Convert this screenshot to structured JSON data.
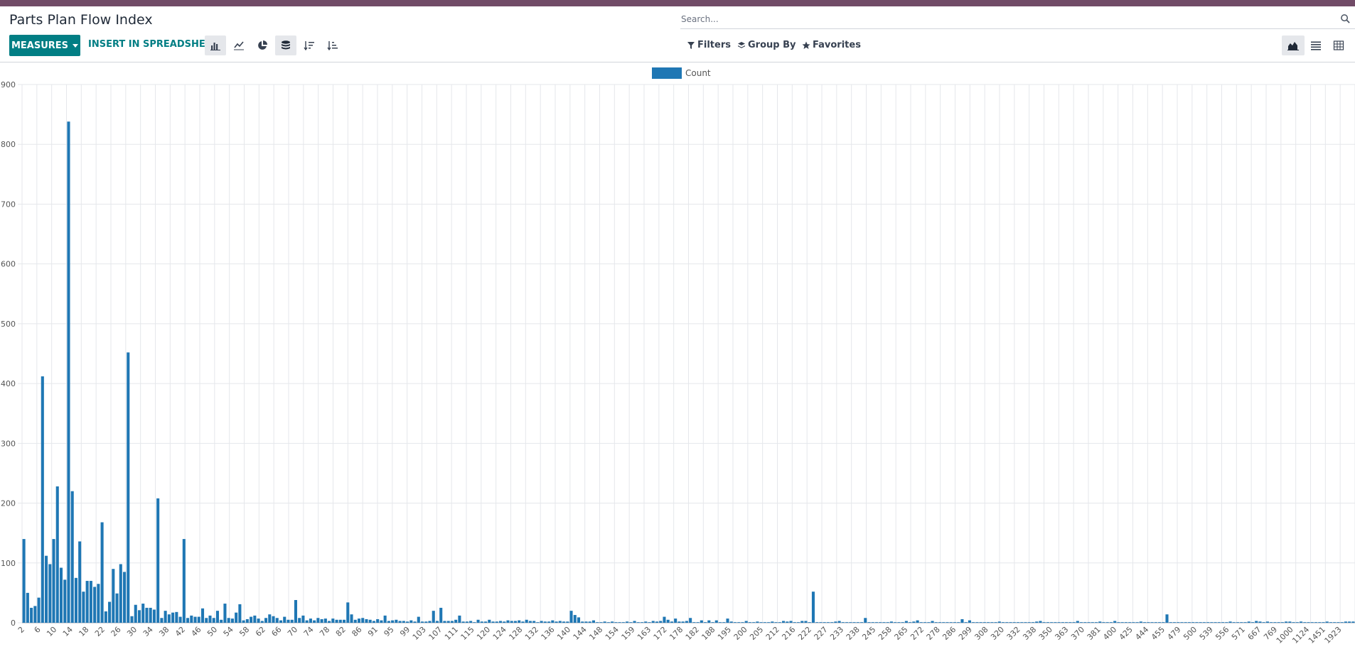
{
  "header": {
    "title": "Parts Plan Flow Index",
    "search_placeholder": "Search..."
  },
  "toolbar": {
    "measures_label": "MEASURES",
    "spreadsheet_label": "INSERT IN SPREADSHEET",
    "filters_label": "Filters",
    "groupby_label": "Group By",
    "favorites_label": "Favorites"
  },
  "icons": [
    "bar-chart-icon",
    "line-chart-icon",
    "pie-chart-icon",
    "stacked-icon",
    "sort-desc-icon",
    "sort-asc-icon",
    "filter-icon",
    "layers-icon",
    "star-icon",
    "graph-view-icon",
    "list-view-icon",
    "pivot-view-icon",
    "search-icon"
  ],
  "colors": {
    "accent": "#017e84",
    "bar": "#1f77b4",
    "topbar": "#714b67"
  },
  "chart_data": {
    "type": "bar",
    "legend": [
      "Count"
    ],
    "legend_position": "top-center",
    "grid": true,
    "ylim": [
      0,
      900
    ],
    "yticks": [
      0,
      100,
      200,
      300,
      400,
      500,
      600,
      700,
      800,
      900
    ],
    "xtick_labels": [
      "2",
      "6",
      "10",
      "14",
      "18",
      "22",
      "26",
      "30",
      "34",
      "38",
      "42",
      "46",
      "50",
      "54",
      "58",
      "62",
      "66",
      "70",
      "74",
      "78",
      "82",
      "86",
      "91",
      "95",
      "99",
      "103",
      "107",
      "111",
      "115",
      "120",
      "124",
      "128",
      "132",
      "136",
      "140",
      "144",
      "148",
      "154",
      "159",
      "163",
      "172",
      "178",
      "182",
      "188",
      "195",
      "200",
      "205",
      "212",
      "216",
      "222",
      "227",
      "233",
      "238",
      "245",
      "258",
      "265",
      "272",
      "278",
      "286",
      "299",
      "308",
      "320",
      "332",
      "338",
      "350",
      "363",
      "370",
      "381",
      "400",
      "425",
      "444",
      "455",
      "479",
      "500",
      "539",
      "556",
      "571",
      "667",
      "769",
      "1000",
      "1124",
      "1451",
      "1923"
    ],
    "values": [
      140,
      50,
      25,
      28,
      42,
      412,
      112,
      98,
      140,
      228,
      92,
      72,
      838,
      220,
      75,
      136,
      52,
      70,
      70,
      60,
      65,
      168,
      19,
      35,
      90,
      49,
      98,
      85,
      452,
      11,
      30,
      21,
      32,
      25,
      25,
      22,
      208,
      8,
      20,
      14,
      17,
      18,
      10,
      140,
      8,
      12,
      10,
      10,
      24,
      8,
      12,
      8,
      20,
      5,
      32,
      8,
      7,
      17,
      31,
      4,
      6,
      10,
      12,
      7,
      3,
      8,
      14,
      11,
      8,
      4,
      10,
      5,
      5,
      38,
      8,
      12,
      4,
      7,
      4,
      8,
      6,
      7,
      3,
      7,
      5,
      5,
      5,
      34,
      14,
      5,
      7,
      8,
      6,
      5,
      3,
      6,
      4,
      12,
      3,
      4,
      5,
      3,
      3,
      2,
      4,
      2,
      10,
      2,
      2,
      3,
      20,
      3,
      25,
      3,
      3,
      3,
      5,
      12,
      2,
      2,
      3,
      1,
      5,
      2,
      2,
      5,
      2,
      2,
      3,
      2,
      4,
      3,
      3,
      4,
      2,
      5,
      3,
      3,
      1,
      3,
      2,
      2,
      4,
      2,
      3,
      2,
      2,
      20,
      13,
      9,
      2,
      2,
      2,
      4,
      1,
      1,
      2,
      1,
      2,
      1,
      1,
      1,
      2,
      1,
      3,
      1,
      1,
      2,
      1,
      3,
      2,
      3,
      10,
      5,
      2,
      7,
      2,
      2,
      3,
      8,
      1,
      1,
      4,
      1,
      4,
      1,
      4,
      1,
      1,
      7,
      2,
      1,
      1,
      1,
      3,
      1,
      1,
      2,
      1,
      1,
      1,
      2,
      1,
      1,
      3,
      2,
      3,
      1,
      1,
      3,
      3,
      1,
      52,
      1,
      1,
      1,
      1,
      1,
      2,
      3,
      1,
      1,
      1,
      1,
      1,
      1,
      8,
      1,
      1,
      1,
      1,
      1,
      1,
      2,
      1,
      1,
      1,
      3,
      1,
      2,
      4,
      1,
      1,
      1,
      3,
      1,
      1,
      1,
      1,
      1,
      1,
      1,
      6,
      1,
      4,
      1,
      1,
      1,
      1,
      1,
      1,
      1,
      2,
      1,
      1,
      1,
      1,
      1,
      1,
      1,
      1,
      1,
      2,
      3,
      1,
      1,
      1,
      1,
      1,
      1,
      1,
      1,
      1,
      3,
      1,
      1,
      1,
      1,
      1,
      2,
      1,
      1,
      1,
      3,
      1,
      1,
      1,
      1,
      1,
      1,
      2,
      1,
      1,
      1,
      1,
      1,
      1,
      14,
      1,
      1,
      1,
      1,
      1,
      1,
      1,
      1,
      1,
      1,
      1,
      1,
      1,
      1,
      1,
      1,
      2,
      1,
      1,
      1,
      1,
      2,
      1,
      3,
      2,
      1,
      2,
      1,
      1,
      1,
      1,
      2,
      2,
      1,
      1,
      2,
      1,
      1,
      1,
      1,
      1,
      1,
      2,
      1,
      1,
      1,
      1,
      2,
      2,
      2
    ]
  }
}
